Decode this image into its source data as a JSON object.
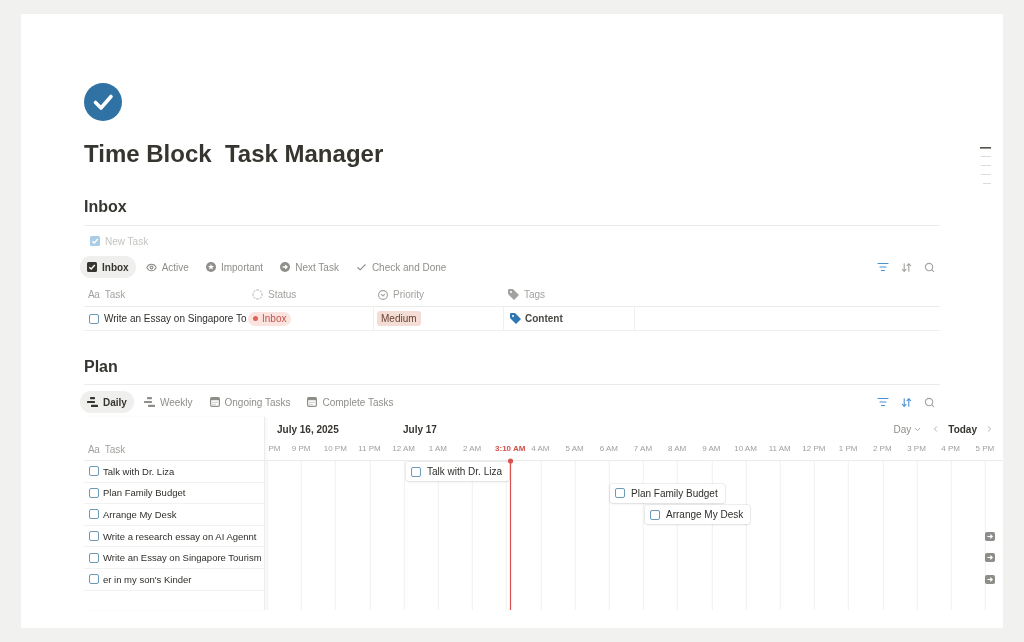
{
  "page": {
    "title": "Time Block  Task Manager"
  },
  "inbox": {
    "heading": "Inbox",
    "new_button": {
      "label": "New Task",
      "disabled": true
    },
    "views": [
      {
        "label": "Inbox",
        "selected": true
      },
      {
        "label": "Active",
        "selected": false
      },
      {
        "label": "Important",
        "selected": false
      },
      {
        "label": "Next Task",
        "selected": false
      },
      {
        "label": "Check and Done",
        "selected": false
      }
    ],
    "tools": {
      "filter_active": true,
      "sort_active": false
    },
    "columns": [
      {
        "kind": "title",
        "glyph": "Aa",
        "label": "Task"
      },
      {
        "kind": "status",
        "label": "Status"
      },
      {
        "kind": "select",
        "label": "Priority"
      },
      {
        "kind": "tags",
        "label": "Tags"
      }
    ],
    "rows": [
      {
        "task": "Write an Essay on Singapore To",
        "checked": false,
        "status": "Inbox",
        "priority": "Medium",
        "tag": "Content"
      }
    ]
  },
  "plan": {
    "heading": "Plan",
    "views": [
      {
        "label": "Daily",
        "selected": true
      },
      {
        "label": "Weekly",
        "selected": false
      },
      {
        "label": "Ongoing Tasks",
        "selected": false
      },
      {
        "label": "Complete Tasks",
        "selected": false
      }
    ],
    "tools": {
      "filter_active": true,
      "sort_active": true
    },
    "timeline": {
      "column": {
        "glyph": "Aa",
        "label": "Task"
      },
      "dates": [
        "July 16, 2025",
        "July 17"
      ],
      "scale": "Day",
      "today": "Today",
      "hours": [
        {
          "label": "PM",
          "kind": "hour"
        },
        {
          "label": "9 PM",
          "kind": "hour"
        },
        {
          "label": "10 PM",
          "kind": "hour"
        },
        {
          "label": "11 PM",
          "kind": "hour"
        },
        {
          "label": "12 AM",
          "kind": "hour"
        },
        {
          "label": "1 AM",
          "kind": "hour"
        },
        {
          "label": "2 AM",
          "kind": "hour"
        },
        {
          "label": "3:10 AM",
          "kind": "now"
        },
        {
          "label": "4 AM",
          "kind": "hour"
        },
        {
          "label": "5 AM",
          "kind": "hour"
        },
        {
          "label": "6 AM",
          "kind": "hour"
        },
        {
          "label": "7 AM",
          "kind": "hour"
        },
        {
          "label": "8 AM",
          "kind": "hour"
        },
        {
          "label": "9 AM",
          "kind": "hour"
        },
        {
          "label": "10 AM",
          "kind": "hour"
        },
        {
          "label": "11 AM",
          "kind": "hour"
        },
        {
          "label": "12 PM",
          "kind": "hour"
        },
        {
          "label": "1 PM",
          "kind": "hour"
        },
        {
          "label": "2 PM",
          "kind": "hour"
        },
        {
          "label": "3 PM",
          "kind": "hour"
        },
        {
          "label": "4 PM",
          "kind": "hour"
        },
        {
          "label": "5 PM",
          "kind": "hour"
        }
      ],
      "rows": [
        {
          "task": "Talk with Dr. Liza",
          "checked": false,
          "kind": "bar",
          "bar": {
            "label": "Talk with Dr. Liza",
            "checked": false
          }
        },
        {
          "task": "Plan Family Budget",
          "checked": false,
          "kind": "bar",
          "bar": {
            "label": "Plan Family Budget",
            "checked": false
          }
        },
        {
          "task": "Arrange My Desk",
          "checked": false,
          "kind": "bar",
          "bar": {
            "label": "Arrange My Desk",
            "checked": false
          }
        },
        {
          "task": "Write a research essay on AI Agennt",
          "checked": false,
          "kind": "offscreen"
        },
        {
          "task": "Write an Essay on Singapore Tourism",
          "checked": false,
          "kind": "offscreen"
        },
        {
          "task": "er in my son's Kinder",
          "checked": false,
          "kind": "offscreen"
        }
      ]
    }
  }
}
